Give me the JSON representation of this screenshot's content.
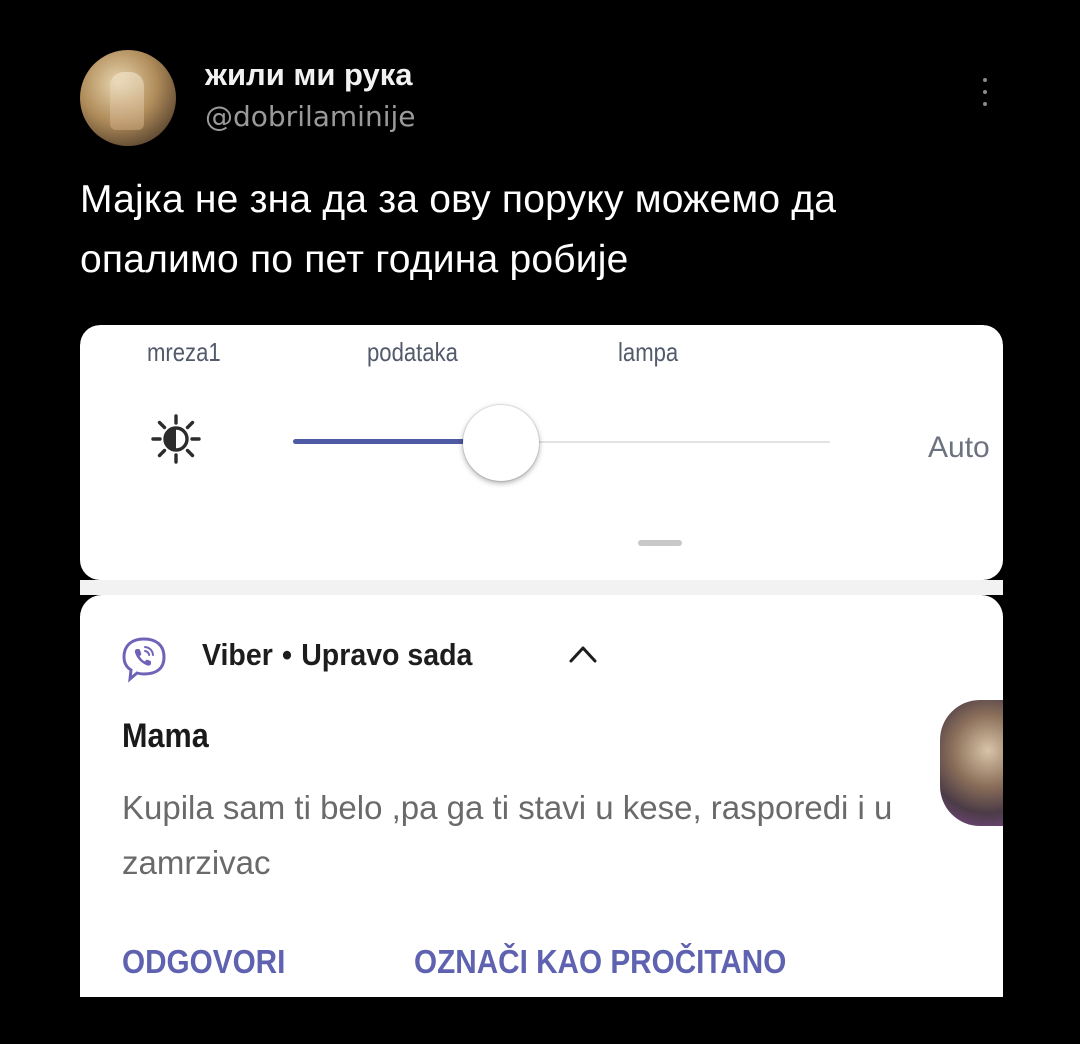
{
  "tweet": {
    "display_name": "жили ми рука",
    "handle": "@dobrilaminije",
    "text": "Мајка не зна да за ову поруку можемо да опалимо по пет година робије"
  },
  "quick_settings": {
    "tile_labels": [
      "mreza1",
      "podataka",
      "lampa"
    ],
    "brightness_level": 0.36,
    "auto_label": "Auto"
  },
  "notification": {
    "app_name": "Viber",
    "separator": "•",
    "time": "Upravo sada",
    "sender": "Mama",
    "message": "Kupila sam ti belo ,pa ga ti stavi u kese, rasporedi i u zamrzivac",
    "actions": [
      "ODGOVORI",
      "OZNAČI KAO PROČITANO"
    ]
  },
  "colors": {
    "accent": "#4f5aa4",
    "action": "#5f62b0",
    "viber": "#6f63b8"
  }
}
